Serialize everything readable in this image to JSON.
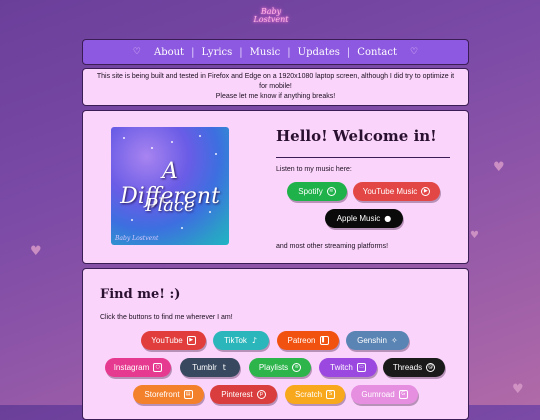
{
  "logo": {
    "line1": "Baby",
    "line2": "Lostvent"
  },
  "nav": {
    "items": [
      "About",
      "Lyrics",
      "Music",
      "Updates",
      "Contact"
    ],
    "separator": "|",
    "heart": "♡"
  },
  "notice": {
    "line1": "This site is being built and tested in Firefox and Edge on a 1920x1080 laptop screen, although I did try to optimize it for mobile!",
    "line2": "Please let me know if anything breaks!"
  },
  "album": {
    "title_line1": "A Different",
    "title_line2": "Place",
    "signature": "Baby Lostvent"
  },
  "welcome": {
    "title": "Hello! Welcome in!",
    "listen": "Listen to my music here:",
    "spotify": "Spotify",
    "youtube_music": "YouTube Music",
    "apple_music": "Apple Music",
    "other": "and most other streaming platforms!"
  },
  "findme": {
    "title": "Find me! :)",
    "subtitle": "Click the buttons to find me wherever I am!",
    "links": {
      "youtube": "YouTube",
      "tiktok": "TikTok",
      "patreon": "Patreon",
      "genshin": "Genshin",
      "instagram": "Instagram",
      "tumblr": "Tumblr",
      "playlists": "Playlists",
      "twitch": "Twitch",
      "threads": "Threads",
      "storefront": "Storefront",
      "pinterest": "Pinterest",
      "scratch": "Scratch",
      "gumroad": "Gumroad"
    }
  },
  "colors": {
    "nav_bg": "#8d59e0",
    "card_bg": "#fbd4fb",
    "spotify": "#1fb24a",
    "youtube_music": "#e34745",
    "apple_music": "#0a0a0a",
    "youtube": "#e23d3d",
    "tiktok": "#2bb6bb",
    "patreon": "#f2520f",
    "genshin": "#5a84b4",
    "instagram": "#e53a8f",
    "tumblr": "#37485f",
    "playlists": "#2db54c",
    "twitch": "#9b48e0",
    "threads": "#1a1a1a",
    "storefront": "#f3812c",
    "pinterest": "#d93d3d",
    "scratch": "#f7a81d",
    "gumroad": "#e68fe0"
  }
}
